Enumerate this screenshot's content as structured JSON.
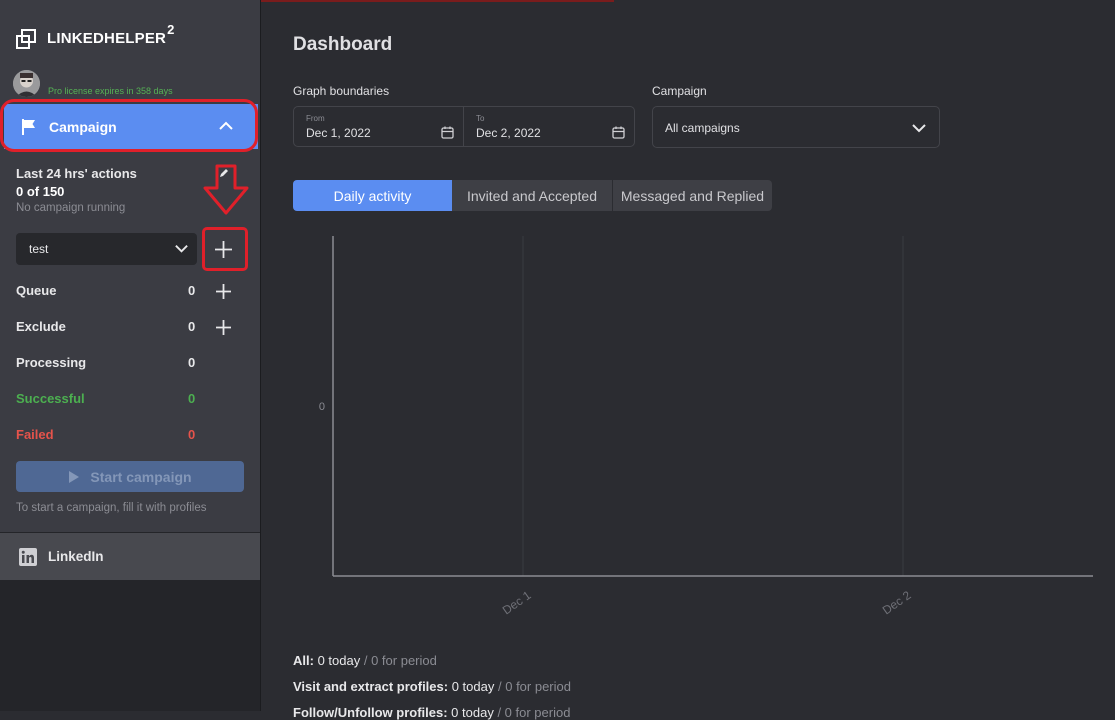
{
  "brand": {
    "name": "LINKEDHELPER",
    "superscript": "2"
  },
  "license_text": "Pro license expires in 358 days",
  "nav": {
    "campaign_label": "Campaign",
    "linkedin_label": "LinkedIn"
  },
  "actions": {
    "title": "Last 24 hrs' actions",
    "count": "0 of 150",
    "status": "No campaign running"
  },
  "campaign_select": {
    "value": "test"
  },
  "stats": [
    {
      "label": "Queue",
      "value": "0",
      "color": "#e8e8ea"
    },
    {
      "label": "Exclude",
      "value": "0",
      "color": "#e8e8ea"
    },
    {
      "label": "Processing",
      "value": "0",
      "color": "#e8e8ea"
    },
    {
      "label": "Successful",
      "value": "0",
      "color": "#4caf50"
    },
    {
      "label": "Failed",
      "value": "0",
      "color": "#e5534b"
    }
  ],
  "start_button": "Start campaign",
  "start_hint": "To start a campaign, fill it with profiles",
  "dashboard": {
    "title": "Dashboard",
    "graph_label": "Graph boundaries",
    "from_label": "From",
    "from_value": "Dec 1, 2022",
    "to_label": "To",
    "to_value": "Dec 2, 2022",
    "campaign_label": "Campaign",
    "campaign_value": "All campaigns",
    "tabs": [
      "Daily activity",
      "Invited and Accepted",
      "Messaged and Replied"
    ]
  },
  "chart_data": {
    "type": "line",
    "categories": [
      "Dec 1",
      "Dec 2"
    ],
    "y_ticks": [
      "0"
    ],
    "series": [],
    "grid": true
  },
  "summary": [
    {
      "label": "All:",
      "today": "0 today",
      "period": "/ 0 for period"
    },
    {
      "label": "Visit and extract profiles:",
      "today": "0 today",
      "period": "/ 0 for period"
    },
    {
      "label": "Follow/Unfollow profiles:",
      "today": "0 today",
      "period": "/ 0 for period"
    }
  ],
  "colors": {
    "accent": "#5b8df1",
    "highlight": "#e0202a"
  }
}
